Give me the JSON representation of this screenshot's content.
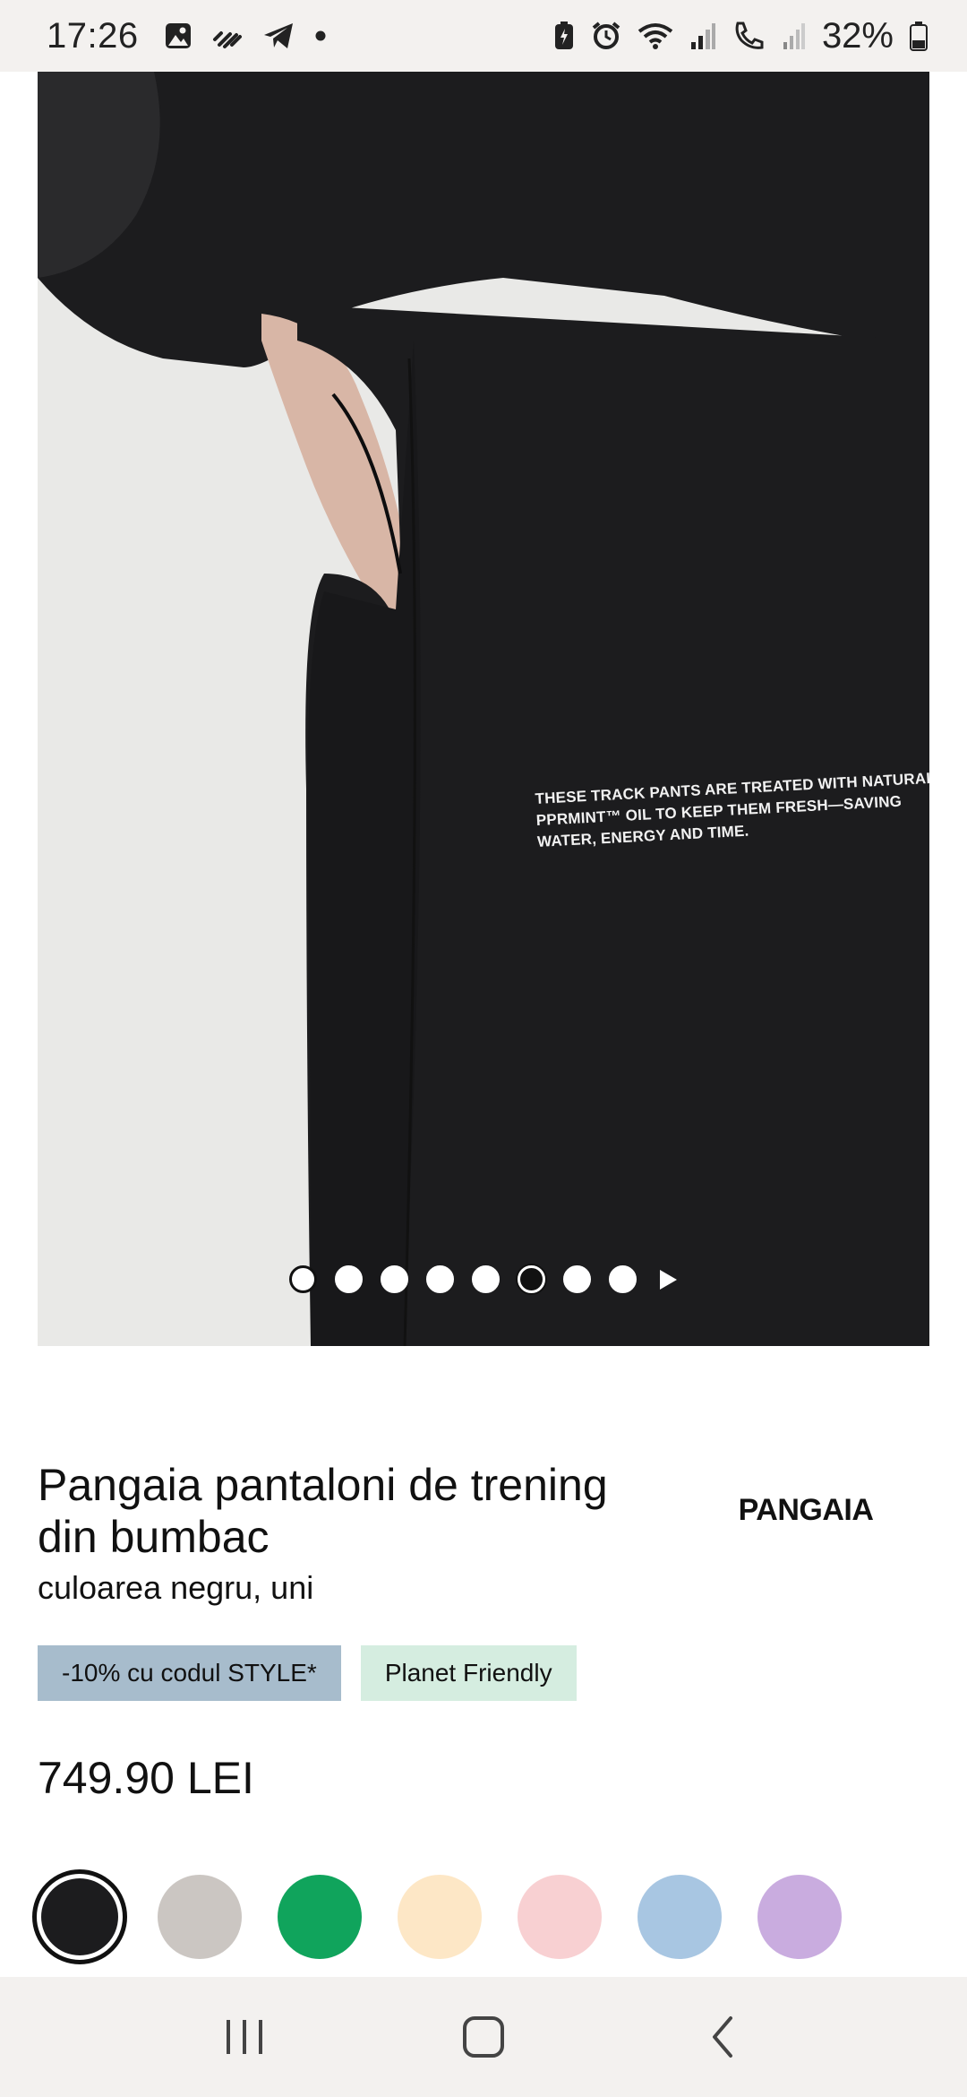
{
  "status_bar": {
    "time": "17:26",
    "left_icons": [
      "gallery-icon",
      "wifi-calling-icon",
      "telegram-icon",
      "dot-icon"
    ],
    "right_icons": [
      "battery-saver-icon",
      "alarm-icon",
      "wifi-icon",
      "signal-icon",
      "call-icon",
      "signal-weak-icon"
    ],
    "battery_percent": "32%"
  },
  "product_image": {
    "print_lines": [
      "THESE TRACK PANTS ARE TREATED WITH NATURAL",
      "PPRMINT™ OIL TO KEEP THEM FRESH—SAVING",
      "WATER, ENERGY AND TIME."
    ],
    "carousel": {
      "total_dots": 8,
      "active_index": 5,
      "outlined_index": 0
    }
  },
  "product": {
    "title": "Pangaia pantaloni de trening din bumbac",
    "subtitle": "culoarea negru, uni",
    "brand": "PANGAIA",
    "badges": {
      "promo": "-10% cu codul STYLE*",
      "eco": "Planet Friendly"
    },
    "price": "749.90 LEI"
  },
  "swatches": {
    "colors": [
      "#1c1c1e",
      "#cbc6c2",
      "#10a45c",
      "#fde7c6",
      "#f8d0d2",
      "#a8c6e2",
      "#c9acdf"
    ],
    "selected_index": 0
  },
  "nav_bar": {
    "buttons": [
      "recents-icon",
      "home-icon",
      "back-icon"
    ]
  }
}
